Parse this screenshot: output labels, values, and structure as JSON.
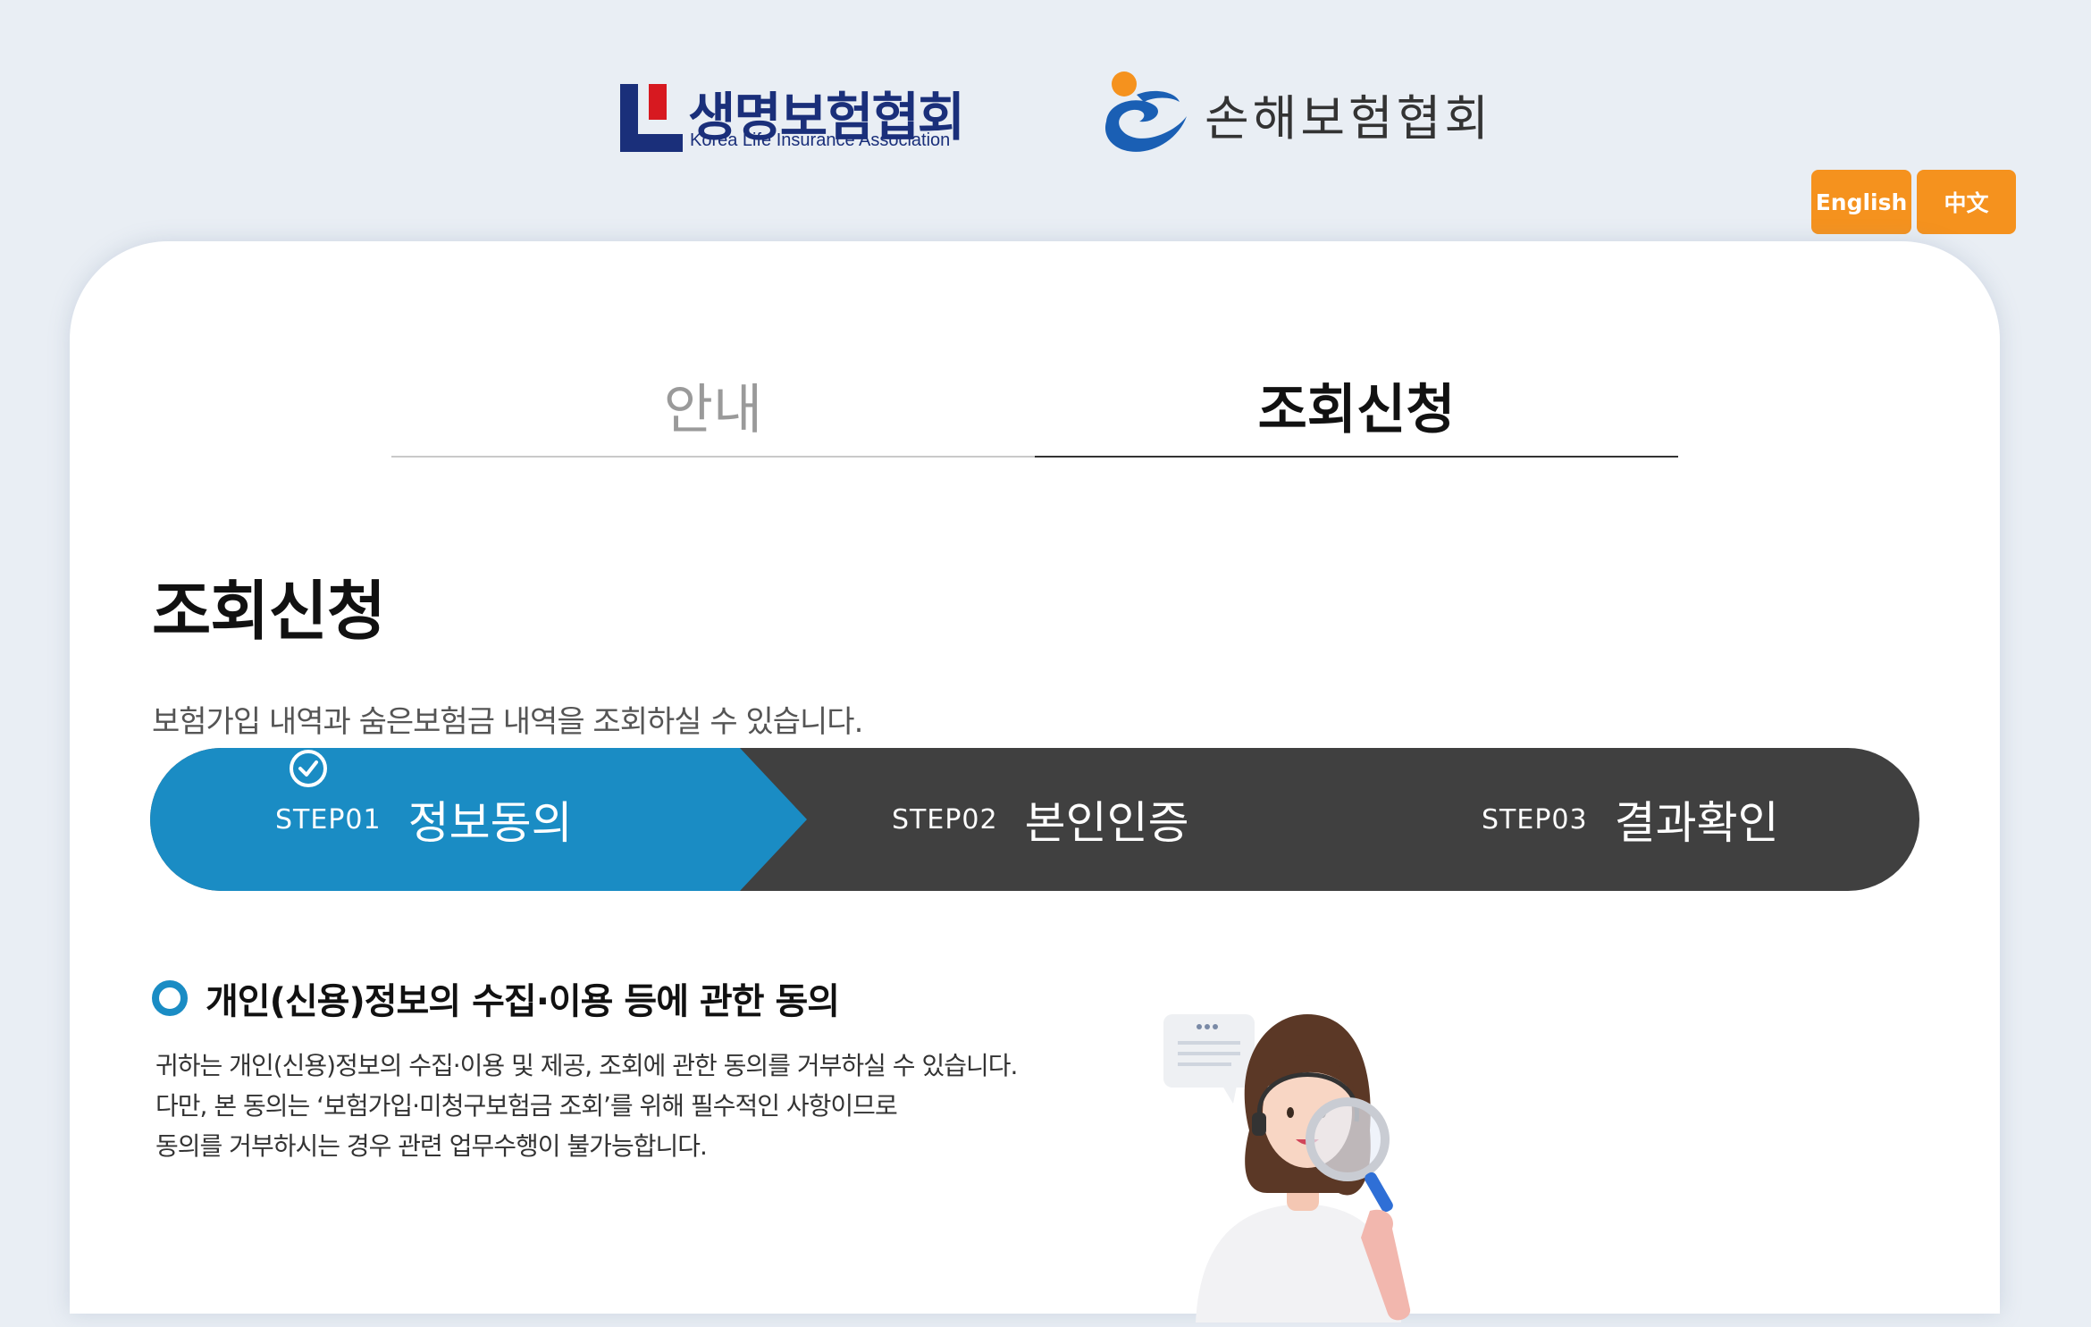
{
  "header": {
    "klia": {
      "name": "생명보험협회",
      "english": "Korea Life Insurance Association"
    },
    "gia": {
      "name": "손해보험협회"
    },
    "languages": [
      "English",
      "中文"
    ]
  },
  "tabs": [
    {
      "label": "안내",
      "active": false
    },
    {
      "label": "조회신청",
      "active": true
    }
  ],
  "page": {
    "title": "조회신청",
    "description": "보험가입 내역과 숨은보험금 내역을 조회하실 수 있습니다."
  },
  "steps": [
    {
      "num": "STEP01",
      "label": "정보동의",
      "active": true
    },
    {
      "num": "STEP02",
      "label": "본인인증",
      "active": false
    },
    {
      "num": "STEP03",
      "label": "결과확인",
      "active": false
    }
  ],
  "consent": {
    "title": "개인(신용)정보의 수집·이용 등에 관한 동의",
    "lines": [
      "귀하는 개인(신용)정보의 수집·이용 및 제공, 조회에 관한 동의를 거부하실 수 있습니다.",
      "다만, 본 동의는 ‘보험가입·미청구보험금 조회’를 위해 필수적인 사항이므로",
      "동의를 거부하시는 경우 관련 업무수행이 불가능합니다."
    ]
  },
  "colors": {
    "accent_blue": "#1a8cc4",
    "step_dark": "#404040",
    "lang_orange": "#f5921e",
    "klia_navy": "#1a2f7a",
    "klia_red": "#d71920"
  }
}
